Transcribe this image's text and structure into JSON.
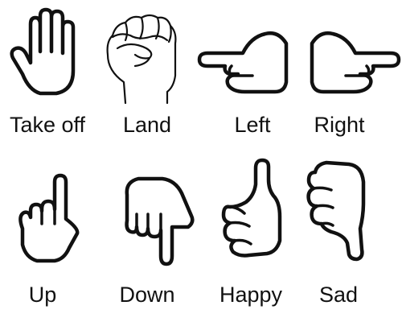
{
  "gestures": [
    {
      "label": "Take off",
      "icon": "open-palm-icon"
    },
    {
      "label": "Land",
      "icon": "raised-fist-icon"
    },
    {
      "label": "Left",
      "icon": "pointing-left-icon"
    },
    {
      "label": "Right",
      "icon": "pointing-right-icon"
    },
    {
      "label": "Up",
      "icon": "pointing-up-icon"
    },
    {
      "label": "Down",
      "icon": "pointing-down-icon"
    },
    {
      "label": "Happy",
      "icon": "thumbs-up-icon"
    },
    {
      "label": "Sad",
      "icon": "thumbs-down-icon"
    }
  ]
}
